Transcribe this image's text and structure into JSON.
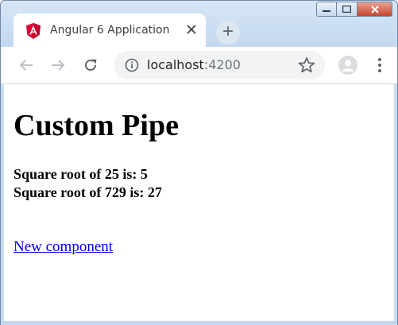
{
  "browser": {
    "tab": {
      "title": "Angular 6 Application",
      "favicon": "angular-icon",
      "close_glyph": "✕"
    },
    "new_tab_glyph": "+",
    "window_controls": {
      "minimize": "minimize-icon",
      "maximize": "maximize-icon",
      "close": "close-icon"
    },
    "address": {
      "host": "localhost",
      "port": ":4200"
    },
    "accent_color": "#dd0031"
  },
  "page": {
    "heading": "Custom Pipe",
    "lines": [
      "Square root of 25 is: 5",
      "Square root of 729 is: 27"
    ],
    "link": "New component"
  }
}
